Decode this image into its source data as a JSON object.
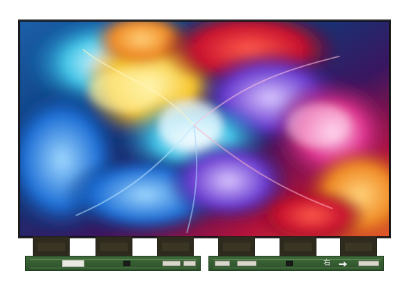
{
  "product": {
    "board_label_left": "",
    "silkscreen_right": "右",
    "arrow_icon": "arrow-right-icon"
  },
  "colors": {
    "panel_bezel": "#0b0b12",
    "pcb": "#2c4f29",
    "cof_film": "#2e2a1d"
  }
}
